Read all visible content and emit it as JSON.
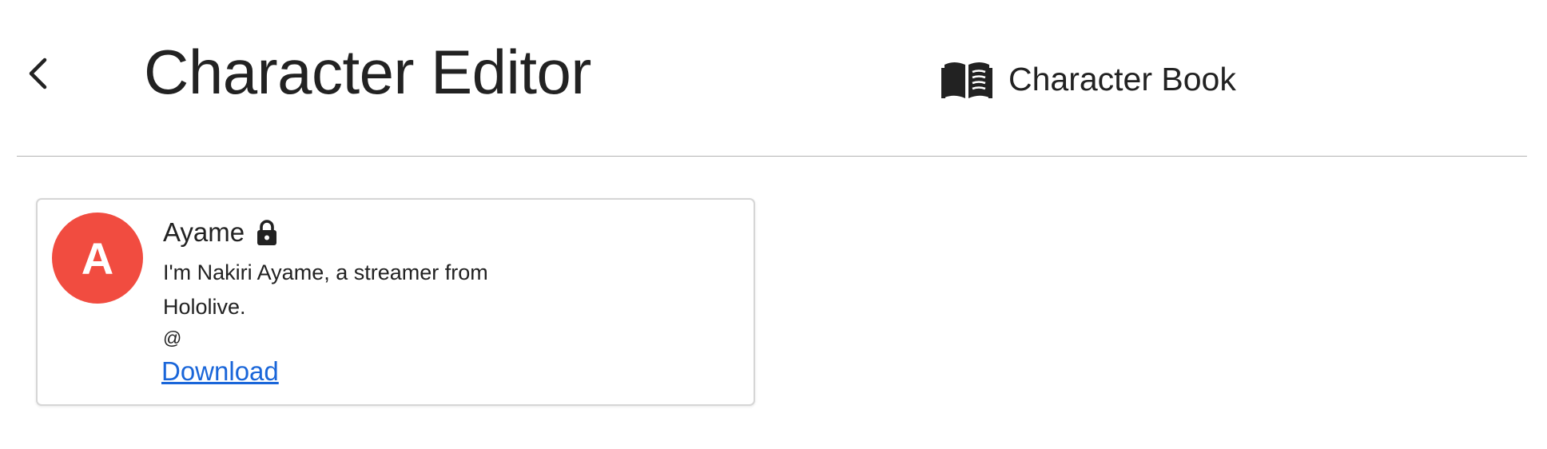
{
  "header": {
    "back_icon": "chevron-left-icon",
    "title": "Character Editor",
    "book_icon": "open-book-icon",
    "book_label": "Character Book"
  },
  "character": {
    "avatar_letter": "A",
    "avatar_color": "#f14c40",
    "name": "Ayame",
    "locked_icon": "lock-icon",
    "description": "I'm Nakiri Ayame, a streamer from Hololive.",
    "handle": "@",
    "download_label": "Download",
    "link_color": "#1a66d9"
  }
}
